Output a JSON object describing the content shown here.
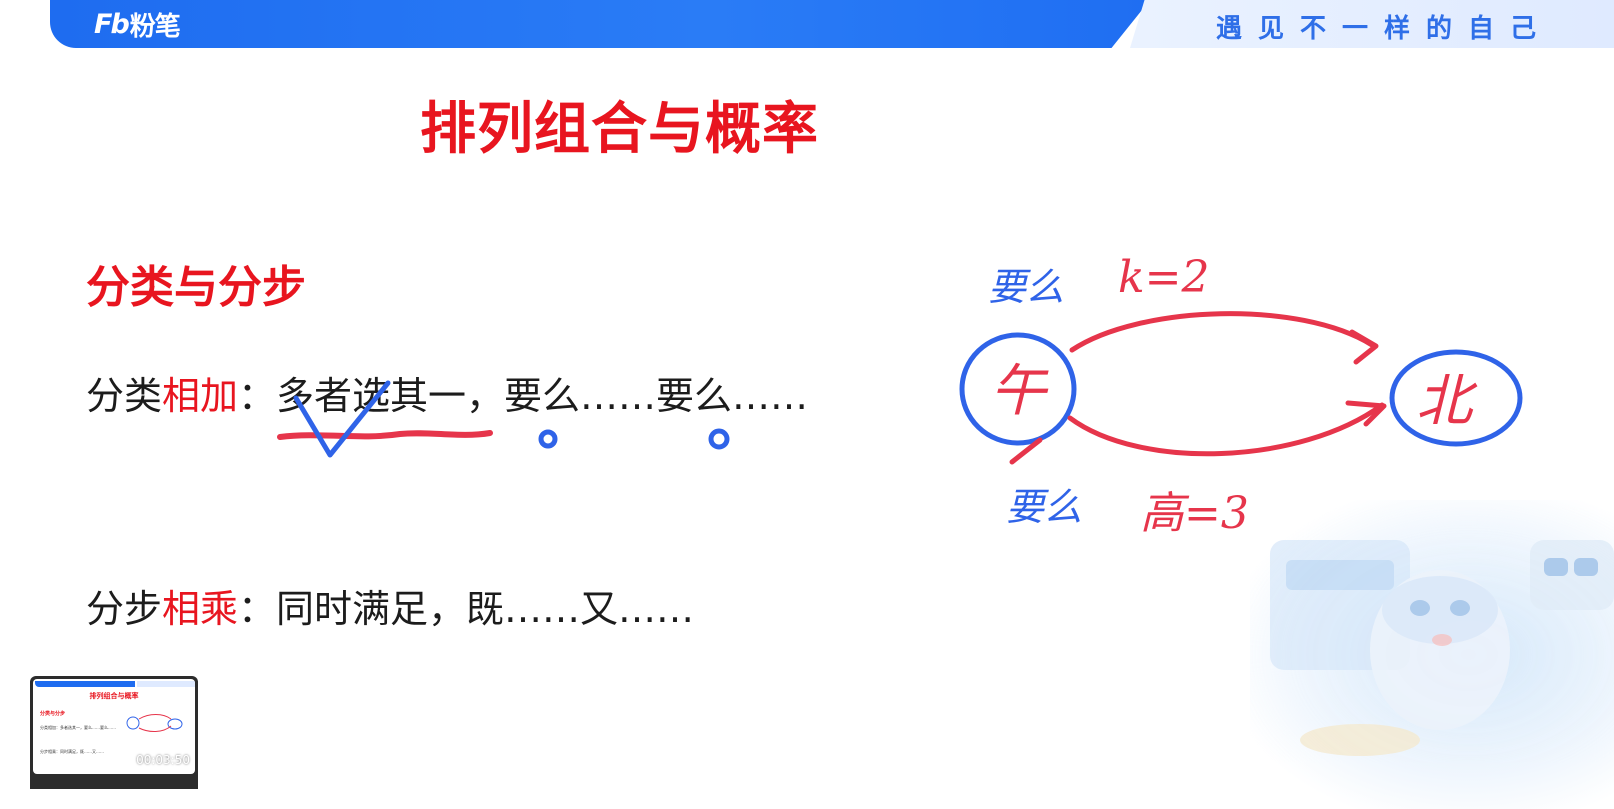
{
  "header": {
    "logo_mark": "Fb",
    "logo_text": "粉笔",
    "slogan": "遇见不一样的自己"
  },
  "slide": {
    "title": "排列组合与概率",
    "section_heading": "分类与分步",
    "rule_add": {
      "prefix": "分类",
      "keyword": "相加",
      "text": "：多者选其一，要么……要么……"
    },
    "rule_multiply": {
      "prefix": "分步",
      "keyword": "相乘",
      "text": "：同时满足，既……又……"
    }
  },
  "handwriting": {
    "top_route_label": "要么",
    "top_route_value": "k=2",
    "bottom_route_label": "要么",
    "bottom_route_value": "高=3",
    "start_node": "午",
    "end_node": "北"
  },
  "thumbnail": {
    "title": "排列组合与概率",
    "section": "分类与分步",
    "line1": "分类相加：多者选其一，要么……要么……",
    "line2": "分步相乘：同时满足，既……又……",
    "timestamp": "00:03:50"
  },
  "colors": {
    "brand_blue": "#1e6cf0",
    "accent_red": "#e8151f",
    "ink_blue": "#2f63e8",
    "ink_red": "#e6354b"
  }
}
